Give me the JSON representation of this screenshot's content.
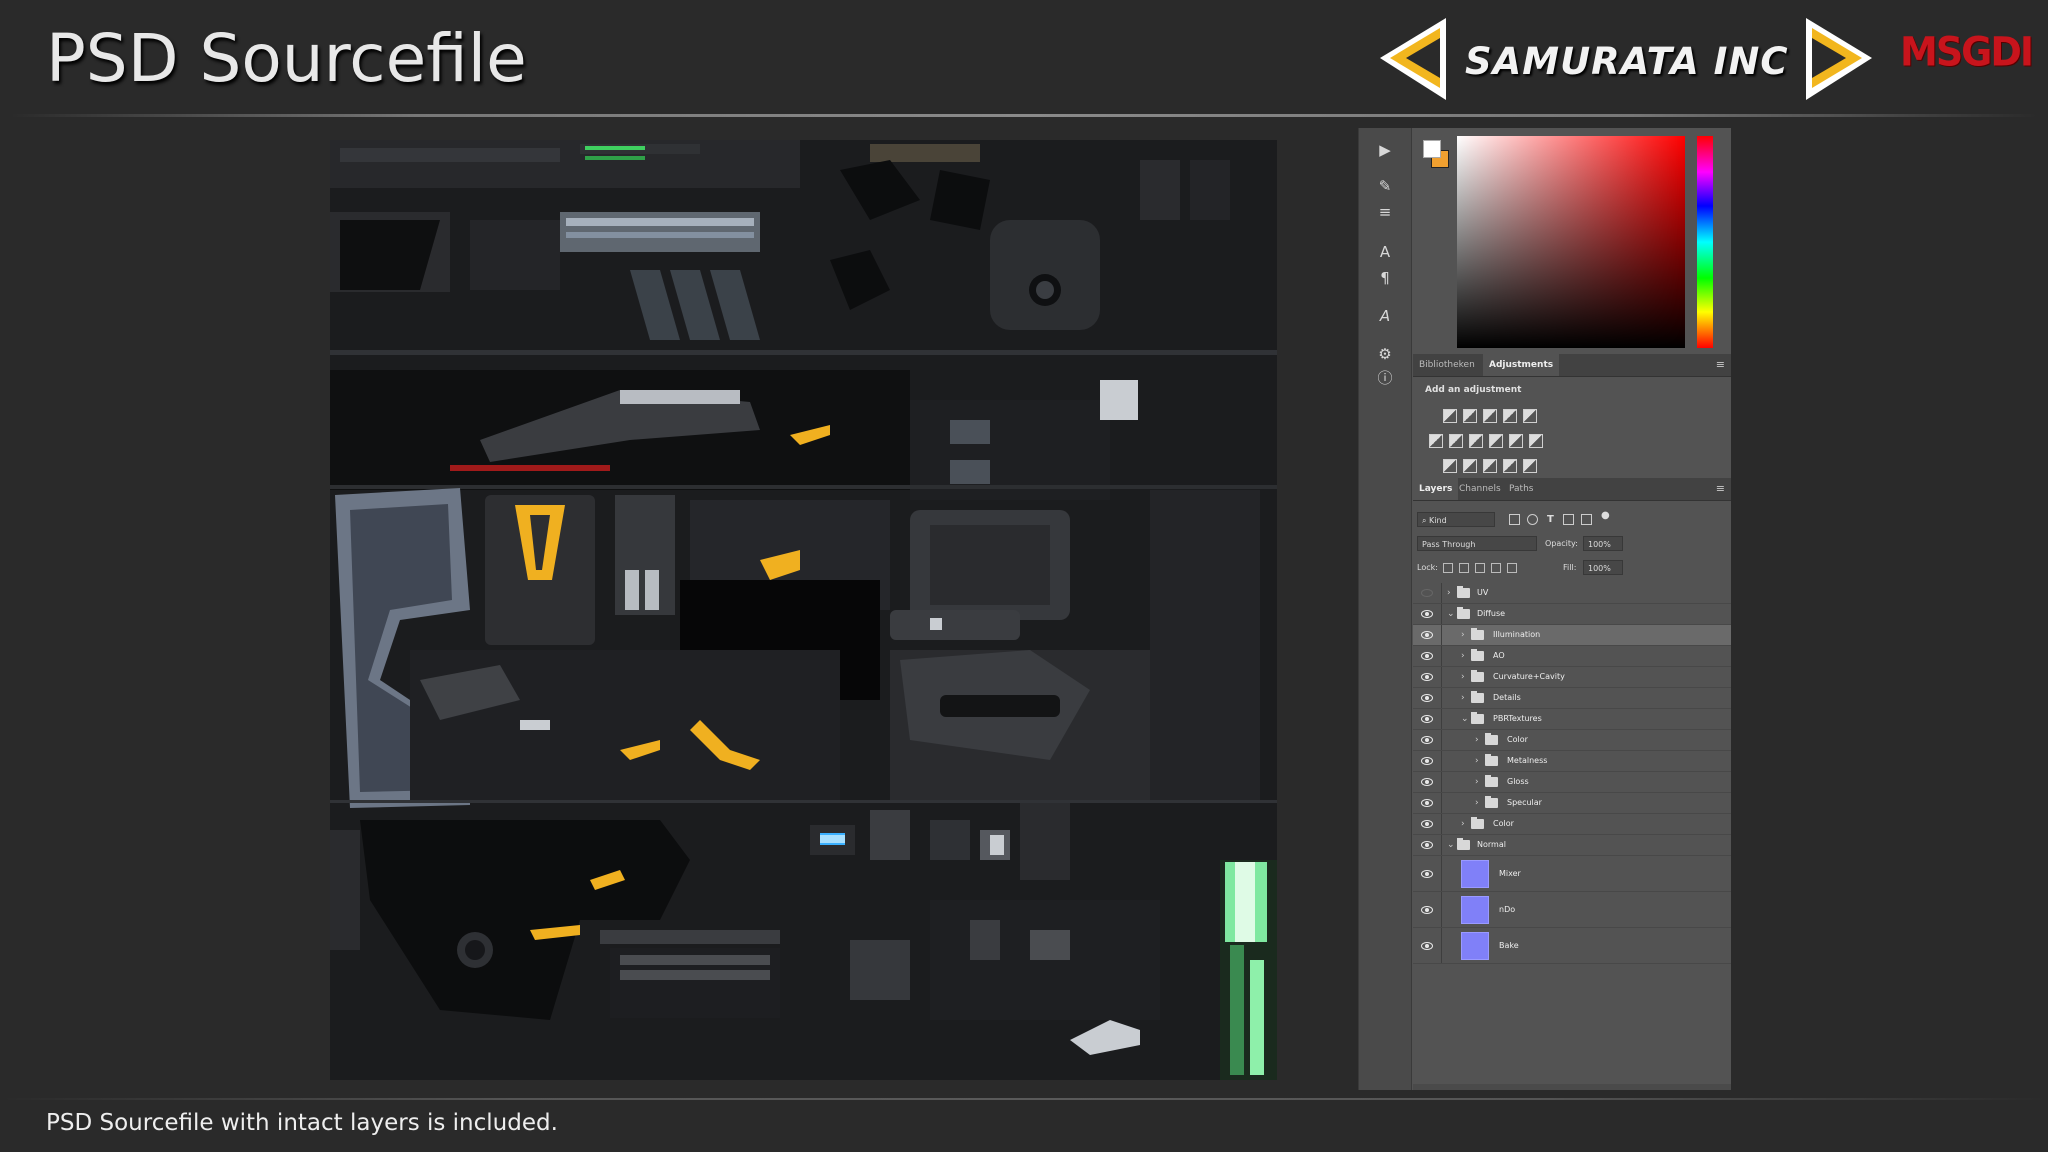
{
  "header": {
    "title": "PSD Sourcefile",
    "brand_name": "SAMURATA INC",
    "brand_logo_text": "MSGDI"
  },
  "footer": {
    "caption": "PSD Sourcefile with intact layers is included."
  },
  "photoshop": {
    "color_panel": {
      "foreground_color": "#ffffff",
      "background_color": "#f0a030",
      "hue": "#ff0000"
    },
    "adjustments_panel": {
      "tabs": [
        "Bibliotheken",
        "Adjustments"
      ],
      "active_tab": "Adjustments",
      "title": "Add an adjustment"
    },
    "layers_panel": {
      "tabs": [
        "Layers",
        "Channels",
        "Paths"
      ],
      "active_tab": "Layers",
      "filter_kind": "Kind",
      "blend_mode": "Pass Through",
      "opacity_label": "Opacity:",
      "opacity_value": "100%",
      "lock_label": "Lock:",
      "fill_label": "Fill:",
      "fill_value": "100%",
      "layers": [
        {
          "name": "UV",
          "type": "group",
          "level": 0,
          "visible": false,
          "expanded": false
        },
        {
          "name": "Diffuse",
          "type": "group",
          "level": 0,
          "visible": true,
          "expanded": true
        },
        {
          "name": "Illumination",
          "type": "group",
          "level": 1,
          "visible": true,
          "expanded": false,
          "selected": true
        },
        {
          "name": "AO",
          "type": "group",
          "level": 1,
          "visible": true,
          "expanded": false
        },
        {
          "name": "Curvature+Cavity",
          "type": "group",
          "level": 1,
          "visible": true,
          "expanded": false
        },
        {
          "name": "Details",
          "type": "group",
          "level": 1,
          "visible": true,
          "expanded": false
        },
        {
          "name": "PBRTextures",
          "type": "group",
          "level": 1,
          "visible": true,
          "expanded": true
        },
        {
          "name": "Color",
          "type": "group",
          "level": 2,
          "visible": true,
          "expanded": false
        },
        {
          "name": "Metalness",
          "type": "group",
          "level": 2,
          "visible": true,
          "expanded": false
        },
        {
          "name": "Gloss",
          "type": "group",
          "level": 2,
          "visible": true,
          "expanded": false
        },
        {
          "name": "Specular",
          "type": "group",
          "level": 2,
          "visible": true,
          "expanded": false
        },
        {
          "name": "Color",
          "type": "group",
          "level": 1,
          "visible": true,
          "expanded": false
        },
        {
          "name": "Normal",
          "type": "group",
          "level": 0,
          "visible": true,
          "expanded": true
        },
        {
          "name": "Mixer",
          "type": "layer",
          "level": 1,
          "visible": true
        },
        {
          "name": "nDo",
          "type": "layer",
          "level": 1,
          "visible": true
        },
        {
          "name": "Bake",
          "type": "layer",
          "level": 1,
          "visible": true
        }
      ]
    }
  },
  "colors": {
    "background": "#2a2a2a",
    "brand_arrow": "#f2b61e",
    "brand_red": "#c8141c",
    "texture_accent_yellow": "#f0b020",
    "texture_accent_green": "#48e070",
    "normal_map_thumb": "#8080f8"
  }
}
